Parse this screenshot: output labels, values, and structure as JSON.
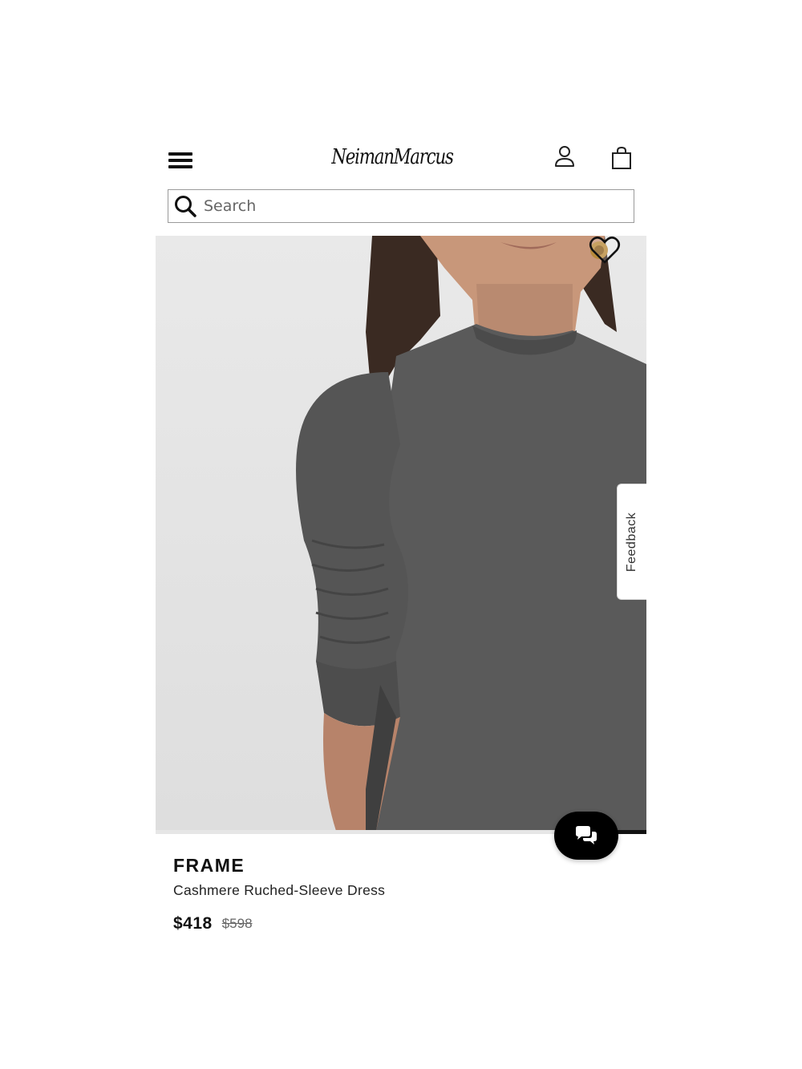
{
  "header": {
    "logo_text": "NeimanMarcus",
    "menu_icon": "hamburger-menu-icon",
    "account_icon": "person-icon",
    "bag_icon": "shopping-bag-icon"
  },
  "search": {
    "placeholder": "Search",
    "icon": "search-icon"
  },
  "product": {
    "favorite_icon": "heart-icon",
    "brand": "FRAME",
    "name": "Cashmere Ruched-Sleeve Dress",
    "sale_price": "$418",
    "original_price": "$598",
    "image_progress": 0.12
  },
  "feedback": {
    "label": "Feedback"
  },
  "chat": {
    "icon": "chat-bubbles-icon"
  },
  "colors": {
    "accent": "#000000",
    "sweater": "#5a5a5a",
    "background": "#e6e6e6"
  }
}
